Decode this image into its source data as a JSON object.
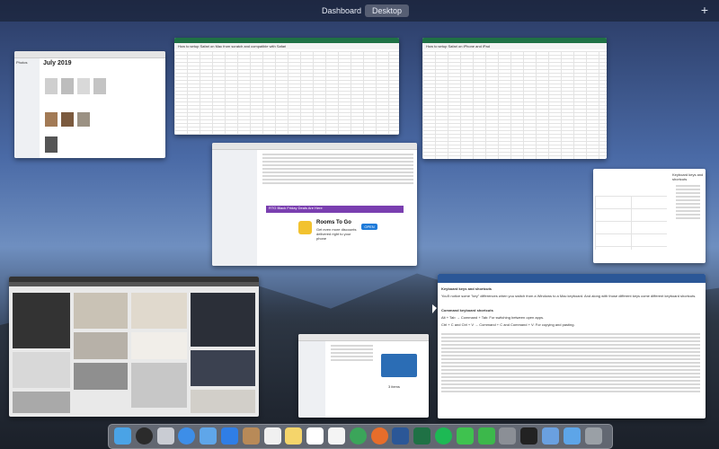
{
  "mission_control": {
    "spaces": [
      {
        "label": "Dashboard",
        "active": false
      },
      {
        "label": "Desktop",
        "active": true
      }
    ],
    "add_space_label": "+"
  },
  "windows": {
    "finder": {
      "title": "July 2019",
      "sidebar_heading": "Photos"
    },
    "excel1": {
      "cell_text": "How to setup Safari on Mac from scratch and compatible with Safari"
    },
    "excel2": {
      "cell_text": "How to setup Safari on iPhone and iPad"
    },
    "mail": {
      "promo_title": "Rooms To Go",
      "promo_text": "Get even more discounts delivered right to your phone",
      "promo_button": "OPEN",
      "banner": "RTG Black Friday Deals Are Here"
    },
    "word_right": {
      "heading": "Keyboard keys and shortcuts"
    },
    "word_bottom": {
      "heading": "Keyboard keys and shortcuts",
      "para1": "You'll notice some \"key\" differences when you switch from a Windows to a Mac keyboard. And along with those different keys come different keyboard shortcuts.",
      "sub1": "Command keyboard shortcuts",
      "item1": "Alt + Tab → Command + Tab: For switching between open apps.",
      "item2": "Ctrl + C and Ctrl + V → Command + C and Command + V: For copying and pasting."
    },
    "photos_grid": {
      "tab": "Photos"
    },
    "finder_small": {
      "caption": "3 items"
    }
  },
  "dock": {
    "icons": [
      "finder-icon",
      "siri-icon",
      "launchpad-icon",
      "safari-icon",
      "mail-icon",
      "app-store-icon",
      "contacts-icon",
      "photos-icon",
      "notes-icon",
      "calendar-icon",
      "reminders-icon",
      "chrome-icon",
      "firefox-icon",
      "word-icon",
      "excel-icon",
      "spotify-icon",
      "messages-icon",
      "facetime-icon",
      "system-preferences-icon",
      "terminal-icon",
      "preview-icon",
      "finder-folder-icon",
      "trash-icon"
    ],
    "colors": [
      "#4aa3e6",
      "#2b2b2b",
      "#c9ccd3",
      "#3d8ee8",
      "#5fa6e9",
      "#2f7ee6",
      "#b88a58",
      "#f0f0f0",
      "#f5d56b",
      "#ffffff",
      "#f4f4f4",
      "#3ba55a",
      "#e76d2a",
      "#2b5797",
      "#1f7145",
      "#1db954",
      "#3fc24f",
      "#3cb84b",
      "#8b8f96",
      "#222222",
      "#6aa0e0",
      "#5da5e8",
      "#9aa0a6"
    ]
  }
}
